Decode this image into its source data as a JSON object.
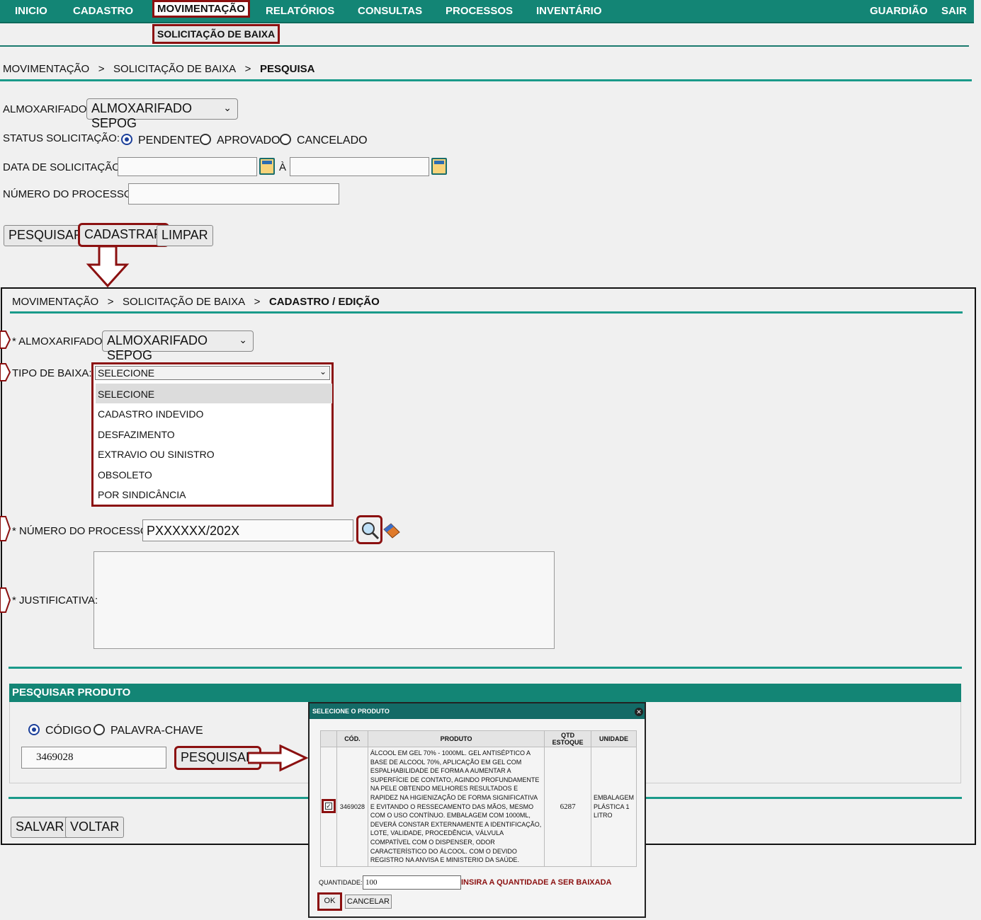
{
  "nav": {
    "items": [
      "INICIO",
      "CADASTRO",
      "MOVIMENTAÇÃO",
      "RELATÓRIOS",
      "CONSULTAS",
      "PROCESSOS",
      "INVENTÁRIO"
    ],
    "right": [
      "GUARDIÃO",
      "SAIR"
    ],
    "submenu": "SOLICITAÇÃO DE BAIXA"
  },
  "search_page": {
    "breadcrumb": [
      "MOVIMENTAÇÃO",
      ">",
      "SOLICITAÇÃO DE BAIXA",
      ">",
      "PESQUISA"
    ],
    "almox_label": "ALMOXARIFADO:",
    "almox_value": "ALMOXARIFADO SEPOG",
    "status_label": "STATUS SOLICITAÇÃO:",
    "status_options": [
      "PENDENTE",
      "APROVADO",
      "CANCELADO"
    ],
    "date_label": "DATA DE SOLICITAÇÃO:",
    "date_sep": "À",
    "process_label": "NÚMERO DO PROCESSO:",
    "buttons": [
      "PESQUISAR",
      "CADASTRAR",
      "LIMPAR"
    ]
  },
  "edit_page": {
    "breadcrumb": [
      "MOVIMENTAÇÃO",
      ">",
      "SOLICITAÇÃO DE BAIXA",
      ">",
      "CADASTRO / EDIÇÃO"
    ],
    "almox_label": "* ALMOXARIFADO:",
    "almox_value": "ALMOXARIFADO SEPOG",
    "tipo_label": "TIPO DE BAIXA:",
    "tipo_value": "SELECIONE",
    "tipo_options": [
      "SELECIONE",
      "CADASTRO INDEVIDO",
      "DESFAZIMENTO",
      "EXTRAVIO OU SINISTRO",
      "OBSOLETO",
      "POR SINDICÂNCIA"
    ],
    "process_label": "* NÚMERO DO PROCESSO:",
    "process_value": "PXXXXXX/202X",
    "justificativa_label": "* JUSTIFICATIVA:",
    "section_title": "PESQUISAR PRODUTO",
    "search_mode": [
      "CÓDIGO",
      "PALAVRA-CHAVE"
    ],
    "code_value": "3469028",
    "search_button": "PESQUISAR",
    "buttons": [
      "SALVAR",
      "VOLTAR"
    ]
  },
  "dialog": {
    "title": "SELECIONE O PRODUTO",
    "headers": [
      "CÓD.",
      "PRODUTO",
      "QTD ESTOQUE",
      "UNIDADE"
    ],
    "row": {
      "code": "3469028",
      "product": "ÁLCOOL EM GEL 70% - 1000ML. GEL ANTISÉPTICO A BASE DE ALCOOL 70%, APLICAÇÃO EM GEL COM ESPALHABILIDADE DE FORMA A AUMENTAR A SUPERFÍCIE DE CONTATO, AGINDO PROFUNDAMENTE NA PELE OBTENDO MELHORES RESULTADOS E RAPIDEZ NA HIGIENIZAÇÃO DE FORMA SIGNIFICATIVA E EVITANDO O RESSECAMENTO DAS MÃOS, MESMO COM O USO CONTÍNUO. EMBALAGEM COM 1000ML, DEVERÁ CONSTAR EXTERNAMENTE A IDENTIFICAÇÃO, LOTE, VALIDADE, PROCEDÊNCIA, VÁLVULA COMPATÍVEL COM O DISPENSER, ODOR CARACTERÍSTICO DO ÁLCOOL. COM O DEVIDO REGISTRO NA ANVISA E MINISTERIO DA SAÚDE.",
      "stock": "6287",
      "unit": "EMBALAGEM PLÁSTICA 1 LITRO"
    },
    "qty_label": "QUANTIDADE:",
    "qty_value": "100",
    "qty_hint": "INSIRA A QUANTIDADE A SER BAIXADA",
    "ok": "OK",
    "cancel": "CANCELAR"
  },
  "colors": {
    "accent": "#138575",
    "highlight": "#8b1010"
  }
}
